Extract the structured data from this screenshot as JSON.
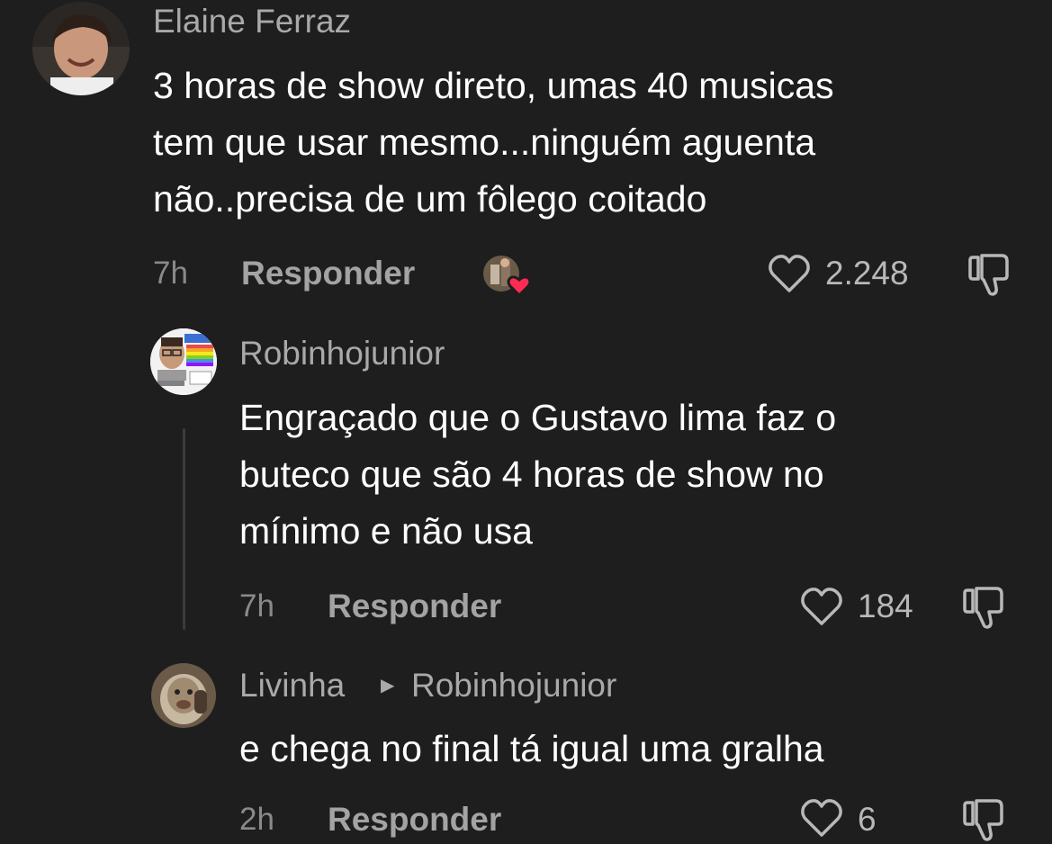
{
  "comments": [
    {
      "username": "Elaine Ferraz",
      "text": "3 horas de show direto, umas 40 musicas\ntem que usar mesmo...ninguém aguenta\nnão..precisa de um fôlego coitado",
      "time": "7h",
      "reply_label": "Responder",
      "likes": "2.248",
      "creator_liked": true
    },
    {
      "username": "Robinhojunior",
      "text": "Engraçado que o Gustavo lima faz o\nbuteco que são 4 horas de show no\nmínimo e não usa",
      "time": "7h",
      "reply_label": "Responder",
      "likes": "184"
    },
    {
      "username": "Livinha",
      "reply_to": "Robinhojunior",
      "text": "e chega no final tá igual uma gralha",
      "time": "2h",
      "reply_label": "Responder",
      "likes": "6"
    }
  ],
  "icons": {
    "like": "heart-outline-icon",
    "dislike": "thumbs-down-outline-icon",
    "creator_like": "heart-filled-badge-icon",
    "reply_arrow": "caret-right-icon"
  },
  "colors": {
    "background": "#1e1e1e",
    "username": "#a9a9a9",
    "meta": "#8a8a8a",
    "text": "#ffffff",
    "heart_badge": "#fe2c55"
  }
}
